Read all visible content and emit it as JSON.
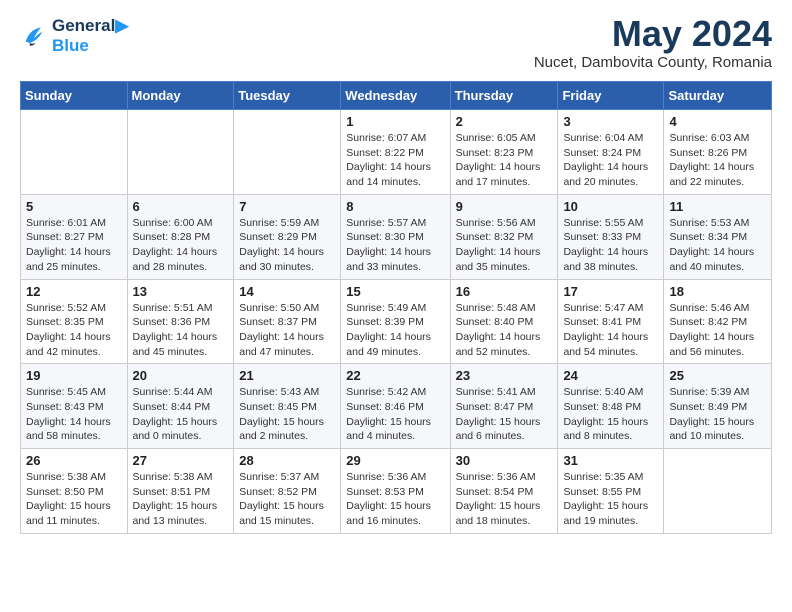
{
  "logo": {
    "line1": "General",
    "line2": "Blue"
  },
  "title": "May 2024",
  "location": "Nucet, Dambovita County, Romania",
  "days_header": [
    "Sunday",
    "Monday",
    "Tuesday",
    "Wednesday",
    "Thursday",
    "Friday",
    "Saturday"
  ],
  "weeks": [
    [
      {
        "day": "",
        "info": ""
      },
      {
        "day": "",
        "info": ""
      },
      {
        "day": "",
        "info": ""
      },
      {
        "day": "1",
        "info": "Sunrise: 6:07 AM\nSunset: 8:22 PM\nDaylight: 14 hours\nand 14 minutes."
      },
      {
        "day": "2",
        "info": "Sunrise: 6:05 AM\nSunset: 8:23 PM\nDaylight: 14 hours\nand 17 minutes."
      },
      {
        "day": "3",
        "info": "Sunrise: 6:04 AM\nSunset: 8:24 PM\nDaylight: 14 hours\nand 20 minutes."
      },
      {
        "day": "4",
        "info": "Sunrise: 6:03 AM\nSunset: 8:26 PM\nDaylight: 14 hours\nand 22 minutes."
      }
    ],
    [
      {
        "day": "5",
        "info": "Sunrise: 6:01 AM\nSunset: 8:27 PM\nDaylight: 14 hours\nand 25 minutes."
      },
      {
        "day": "6",
        "info": "Sunrise: 6:00 AM\nSunset: 8:28 PM\nDaylight: 14 hours\nand 28 minutes."
      },
      {
        "day": "7",
        "info": "Sunrise: 5:59 AM\nSunset: 8:29 PM\nDaylight: 14 hours\nand 30 minutes."
      },
      {
        "day": "8",
        "info": "Sunrise: 5:57 AM\nSunset: 8:30 PM\nDaylight: 14 hours\nand 33 minutes."
      },
      {
        "day": "9",
        "info": "Sunrise: 5:56 AM\nSunset: 8:32 PM\nDaylight: 14 hours\nand 35 minutes."
      },
      {
        "day": "10",
        "info": "Sunrise: 5:55 AM\nSunset: 8:33 PM\nDaylight: 14 hours\nand 38 minutes."
      },
      {
        "day": "11",
        "info": "Sunrise: 5:53 AM\nSunset: 8:34 PM\nDaylight: 14 hours\nand 40 minutes."
      }
    ],
    [
      {
        "day": "12",
        "info": "Sunrise: 5:52 AM\nSunset: 8:35 PM\nDaylight: 14 hours\nand 42 minutes."
      },
      {
        "day": "13",
        "info": "Sunrise: 5:51 AM\nSunset: 8:36 PM\nDaylight: 14 hours\nand 45 minutes."
      },
      {
        "day": "14",
        "info": "Sunrise: 5:50 AM\nSunset: 8:37 PM\nDaylight: 14 hours\nand 47 minutes."
      },
      {
        "day": "15",
        "info": "Sunrise: 5:49 AM\nSunset: 8:39 PM\nDaylight: 14 hours\nand 49 minutes."
      },
      {
        "day": "16",
        "info": "Sunrise: 5:48 AM\nSunset: 8:40 PM\nDaylight: 14 hours\nand 52 minutes."
      },
      {
        "day": "17",
        "info": "Sunrise: 5:47 AM\nSunset: 8:41 PM\nDaylight: 14 hours\nand 54 minutes."
      },
      {
        "day": "18",
        "info": "Sunrise: 5:46 AM\nSunset: 8:42 PM\nDaylight: 14 hours\nand 56 minutes."
      }
    ],
    [
      {
        "day": "19",
        "info": "Sunrise: 5:45 AM\nSunset: 8:43 PM\nDaylight: 14 hours\nand 58 minutes."
      },
      {
        "day": "20",
        "info": "Sunrise: 5:44 AM\nSunset: 8:44 PM\nDaylight: 15 hours\nand 0 minutes."
      },
      {
        "day": "21",
        "info": "Sunrise: 5:43 AM\nSunset: 8:45 PM\nDaylight: 15 hours\nand 2 minutes."
      },
      {
        "day": "22",
        "info": "Sunrise: 5:42 AM\nSunset: 8:46 PM\nDaylight: 15 hours\nand 4 minutes."
      },
      {
        "day": "23",
        "info": "Sunrise: 5:41 AM\nSunset: 8:47 PM\nDaylight: 15 hours\nand 6 minutes."
      },
      {
        "day": "24",
        "info": "Sunrise: 5:40 AM\nSunset: 8:48 PM\nDaylight: 15 hours\nand 8 minutes."
      },
      {
        "day": "25",
        "info": "Sunrise: 5:39 AM\nSunset: 8:49 PM\nDaylight: 15 hours\nand 10 minutes."
      }
    ],
    [
      {
        "day": "26",
        "info": "Sunrise: 5:38 AM\nSunset: 8:50 PM\nDaylight: 15 hours\nand 11 minutes."
      },
      {
        "day": "27",
        "info": "Sunrise: 5:38 AM\nSunset: 8:51 PM\nDaylight: 15 hours\nand 13 minutes."
      },
      {
        "day": "28",
        "info": "Sunrise: 5:37 AM\nSunset: 8:52 PM\nDaylight: 15 hours\nand 15 minutes."
      },
      {
        "day": "29",
        "info": "Sunrise: 5:36 AM\nSunset: 8:53 PM\nDaylight: 15 hours\nand 16 minutes."
      },
      {
        "day": "30",
        "info": "Sunrise: 5:36 AM\nSunset: 8:54 PM\nDaylight: 15 hours\nand 18 minutes."
      },
      {
        "day": "31",
        "info": "Sunrise: 5:35 AM\nSunset: 8:55 PM\nDaylight: 15 hours\nand 19 minutes."
      },
      {
        "day": "",
        "info": ""
      }
    ]
  ]
}
